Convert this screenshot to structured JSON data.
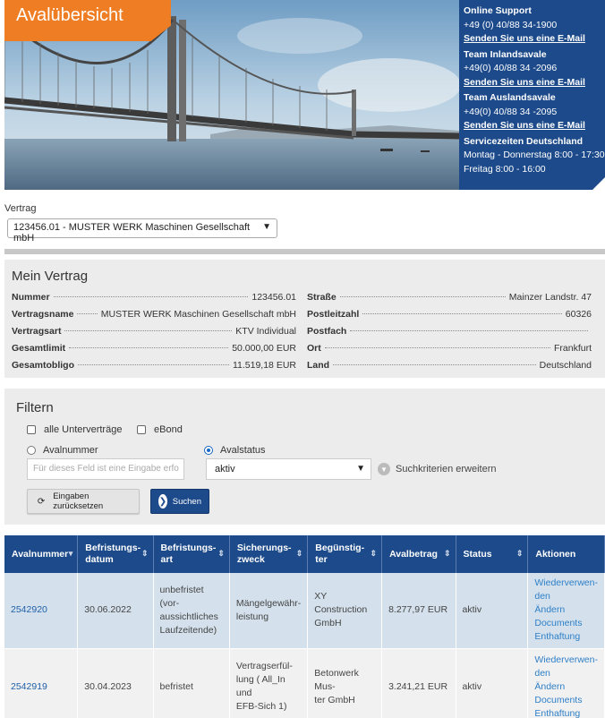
{
  "header": {
    "title": "Avalübersicht",
    "support": [
      {
        "heading": "Online Support",
        "phone": "+49 (0) 40/88 34-1900",
        "mail": "Senden Sie uns eine E-Mail"
      },
      {
        "heading": "Team Inlandsavale",
        "phone": "+49(0) 40/88 34 -2096",
        "mail": "Senden Sie uns eine E-Mail"
      },
      {
        "heading": "Team Auslandsavale",
        "phone": "+49(0) 40/88 34 -2095",
        "mail": "Senden Sie uns eine E-Mail"
      }
    ],
    "service": {
      "heading": "Servicezeiten Deutschland",
      "line1": "Montag - Donnerstag 8:00 - 17:30",
      "line2": "Freitag 8:00 - 16:00"
    }
  },
  "vertrag": {
    "label": "Vertrag",
    "selected": "123456.01 - MUSTER WERK Maschinen Gesellschaft mbH"
  },
  "mein_vertrag": {
    "title": "Mein Vertrag",
    "left": [
      {
        "k": "Nummer",
        "v": "123456.01"
      },
      {
        "k": "Vertragsname",
        "v": "MUSTER WERK Maschinen Gesellschaft mbH"
      },
      {
        "k": "Vertragsart",
        "v": "KTV Individual"
      },
      {
        "k": "Gesamtlimit",
        "v": "50.000,00 EUR"
      },
      {
        "k": "Gesamtobligo",
        "v": "11.519,18 EUR"
      }
    ],
    "right": [
      {
        "k": "Straße",
        "v": "Mainzer Landstr. 47"
      },
      {
        "k": "Postleitzahl",
        "v": "60326"
      },
      {
        "k": "Postfach",
        "v": ""
      },
      {
        "k": "Ort",
        "v": "Frankfurt"
      },
      {
        "k": "Land",
        "v": "Deutschland"
      }
    ]
  },
  "filter": {
    "title": "Filtern",
    "cb_all": "alle Unterverträge",
    "cb_ebond": "eBond",
    "radio_nr": "Avalnummer",
    "radio_status": "Avalstatus",
    "input_placeholder": "Für dieses Feld ist eine Eingabe erfo",
    "status_value": "aktiv",
    "expand": "Suchkriterien erweitern",
    "btn_reset": "Eingaben zurücksetzen",
    "btn_search": "Suchen"
  },
  "table": {
    "headers": [
      "Avalnummer",
      "Befristungs-\ndatum",
      "Befristungs-\nart",
      "Sicherungs-\nzweck",
      "Begünstig-\nter",
      "Avalbetrag",
      "Status",
      "Aktionen"
    ],
    "rows": [
      {
        "nr": "2542920",
        "datum": "30.06.2022",
        "art": "unbefristet (vor-\naussichtliches\nLaufzeitende)",
        "zweck": "Mängelgewähr-\nleistung",
        "beg": "XY Construction\nGmbH",
        "betrag": "8.277,97 EUR",
        "status": "aktiv",
        "actions": [
          "Wiederverwen-\nden",
          "Ändern",
          "Documents",
          "Enthaftung"
        ]
      },
      {
        "nr": "2542919",
        "datum": "30.04.2023",
        "art": "befristet",
        "zweck": "Vertragserfül-\nlung ( All_In und\nEFB-Sich 1)",
        "beg": "Betonwerk Mus-\nter GmbH",
        "betrag": "3.241,21 EUR",
        "status": "aktiv",
        "actions": [
          "Wiederverwen-\nden",
          "Ändern",
          "Documents",
          "Enthaftung"
        ]
      }
    ]
  }
}
